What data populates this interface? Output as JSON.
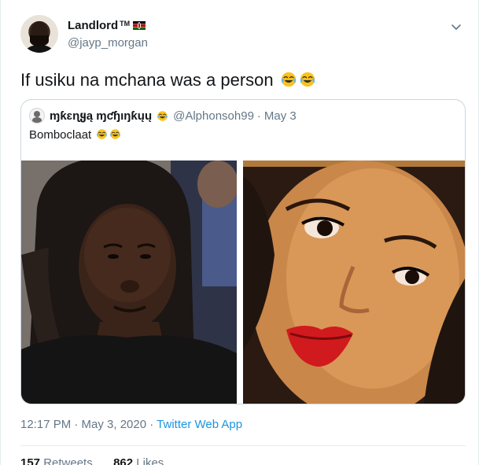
{
  "author": {
    "display_name": "Landlord",
    "trademark": "TM",
    "handle": "@jayp_morgan",
    "flag_icon": "kenya-flag-icon"
  },
  "tweet": {
    "text": "If usiku na mchana was a person",
    "emoji_icon": "face-with-tears-of-joy-icon"
  },
  "quoted_tweet": {
    "display_name": "ɱƙɛɳყą ɱƈɧıŋƙųų",
    "handle": "@Alphonsoh99",
    "separator": "·",
    "date": "May 3",
    "text": "Bomboclaat"
  },
  "footer": {
    "time": "12:17 PM · May 3, 2020 · ",
    "app": "Twitter Web App"
  },
  "stats": {
    "retweets_count": "157",
    "retweets_label": " Retweets",
    "likes_count": "862",
    "likes_label": " Likes"
  },
  "colors": {
    "link": "#1b95e0",
    "secondary_text": "#657786",
    "primary_text": "#14171a",
    "border": "#ccd6dd"
  }
}
